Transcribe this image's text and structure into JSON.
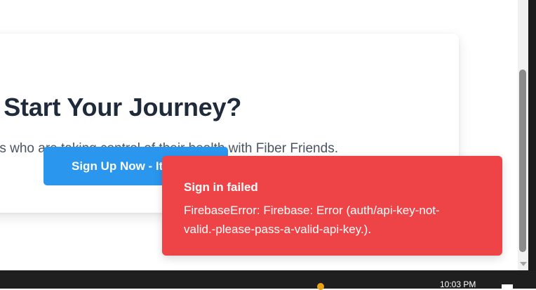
{
  "cta": {
    "title": "Ready to Start Your Journey?",
    "subtitle": "Join thousands of mothers who are taking control of their health with Fiber Friends.",
    "button_label": "Sign Up Now - It"
  },
  "toast": {
    "title": "Sign in failed",
    "message": "FirebaseError: Firebase: Error (auth/api-key-not-valid.-please-pass-a-valid-api-key.)."
  },
  "taskbar": {
    "clock": "10:03 PM"
  },
  "colors": {
    "toast_bg": "#ef4447",
    "button_bg": "#2b96ee",
    "heading": "#1f2a3a"
  }
}
